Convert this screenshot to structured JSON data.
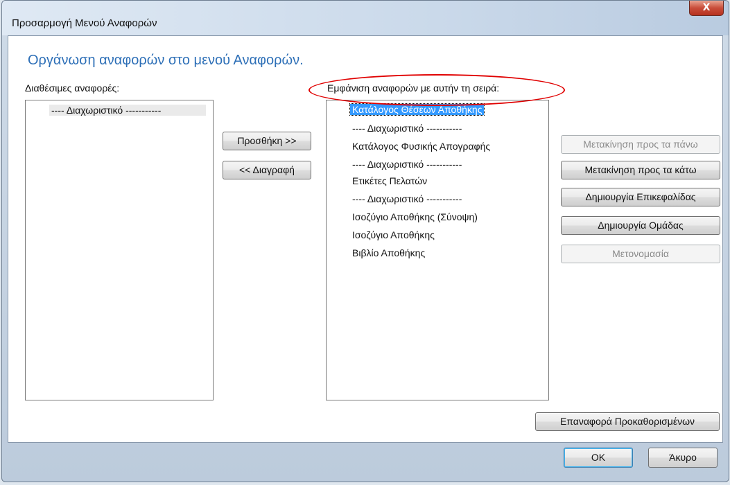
{
  "window": {
    "title": "Προσαρμογή Μενού Αναφορών",
    "close_label": "X"
  },
  "heading": "Οργάνωση αναφορών στο μενού Αναφορών.",
  "available": {
    "label": "Διαθέσιμες αναφορές:",
    "items": [
      "---- Διαχωριστικό -----------"
    ]
  },
  "display": {
    "label": "Εμφάνιση αναφορών με αυτήν τη σειρά:",
    "items": [
      "Κατάλογος Θέσεων Αποθήκης",
      "---- Διαχωριστικό -----------",
      "Κατάλογος Φυσικής Απογραφής",
      "---- Διαχωριστικό -----------",
      "Ετικέτες Πελατών",
      "---- Διαχωριστικό -----------",
      "Ισοζύγιο Αποθήκης (Σύνοψη)",
      "Ισοζύγιο Αποθήκης",
      "Βιβλίο Αποθήκης"
    ],
    "selected_index": 0
  },
  "buttons": {
    "add": "Προσθήκη >>",
    "remove": "<< Διαγραφή",
    "move_up": "Μετακίνηση προς τα πάνω",
    "move_down": "Μετακίνηση προς τα κάτω",
    "create_header": "Δημιουργία Επικεφαλίδας",
    "create_group": "Δημιουργία Ομάδας",
    "rename": "Μετονομασία",
    "restore_defaults": "Επαναφορά Προκαθορισμένων",
    "ok": "OK",
    "cancel": "Άκυρο"
  },
  "annotation": {
    "color": "#e00000"
  }
}
